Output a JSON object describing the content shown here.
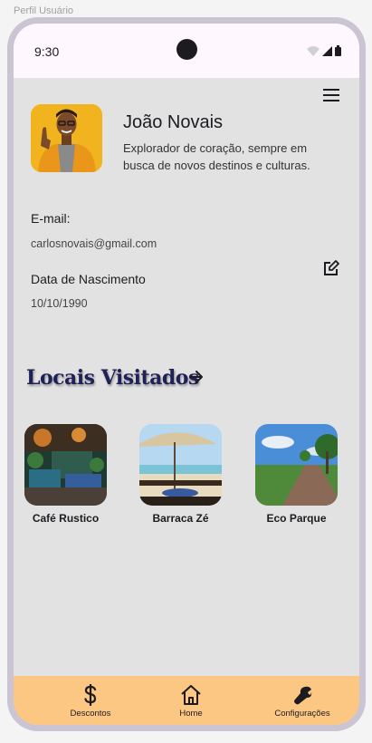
{
  "frame_label": "Perfil Usuário",
  "status": {
    "time": "9:30"
  },
  "profile": {
    "name": "João Novais",
    "bio": "Explorador de coração, sempre em busca de novos destinos e culturas."
  },
  "info": {
    "email_label": "E-mail:",
    "email_value": "carlosnovais@gmail.com",
    "birth_label": "Data de Nascimento",
    "birth_value": "10/10/1990"
  },
  "visited": {
    "title": "Locais Visitados",
    "places": [
      {
        "name": "Café Rustico"
      },
      {
        "name": "Barraca Zé"
      },
      {
        "name": "Eco Parque"
      }
    ]
  },
  "nav": {
    "items": [
      {
        "label": "Descontos",
        "icon": "dollar-icon"
      },
      {
        "label": "Home",
        "icon": "home-icon"
      },
      {
        "label": "Configurações",
        "icon": "wrench-icon"
      }
    ]
  },
  "colors": {
    "status_bar": "#fef7fe",
    "screen_bg": "#e2e2e2",
    "bottom_nav": "#fbc783",
    "title": "#1f2256",
    "avatar_bg": "#f0b31c"
  }
}
